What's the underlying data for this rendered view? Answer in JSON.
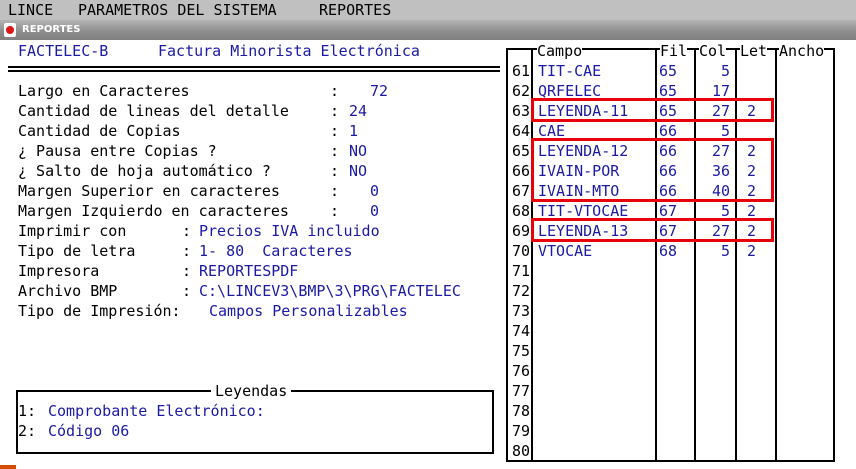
{
  "menu": [
    "LINCE",
    "PARAMETROS DEL SISTEMA",
    "REPORTES"
  ],
  "window": {
    "title": "REPORTES"
  },
  "report": {
    "code": "FACTELEC-B",
    "name": "Factura Minorista Electrónica"
  },
  "settings": [
    {
      "label": "Largo en Caracteres",
      "sep": ":",
      "value": "72"
    },
    {
      "label": "Cantidad de lineas del detalle",
      "sep": ":",
      "value": "24"
    },
    {
      "label": "Cantidad de Copias",
      "sep": ":",
      "value": "1"
    },
    {
      "label": "¿ Pausa entre Copias ?",
      "sep": ":",
      "value": "NO"
    },
    {
      "label": "¿ Salto de hoja automático ?",
      "sep": ":",
      "value": "NO"
    },
    {
      "label": "Margen Superior en caracteres",
      "sep": ":",
      "value": "0"
    },
    {
      "label": "Margen Izquierdo en caracteres",
      "sep": ":",
      "value": "0"
    },
    {
      "label": "Imprimir con",
      "sep": ":",
      "value": "Precios IVA incluido"
    },
    {
      "label": "Tipo de letra",
      "sep": ":",
      "value": "1- 80  Caracteres"
    },
    {
      "label": "Impresora",
      "sep": ":",
      "value": "REPORTESPDF"
    },
    {
      "label": "Archivo BMP",
      "sep": ":",
      "value": "C:\\LINCEV3\\BMP\\3\\PRG\\FACTELEC"
    },
    {
      "label": "Tipo de Impresión:",
      "sep": "",
      "value": "Campos Personalizables"
    }
  ],
  "leyendas": {
    "title": "Leyendas",
    "items": [
      {
        "index": "1:",
        "text": "Comprobante Electrónico:"
      },
      {
        "index": "2:",
        "text": "Código 06"
      }
    ]
  },
  "table": {
    "headers": {
      "campo": "Campo",
      "fil": "Fil",
      "col": "Col",
      "let": "Let",
      "ancho": "Ancho"
    },
    "rows": [
      {
        "n": "61",
        "campo": "TIT-CAE",
        "fil": "65",
        "col": "5",
        "let": ""
      },
      {
        "n": "62",
        "campo": "QRFELEC",
        "fil": "65",
        "col": "17",
        "let": ""
      },
      {
        "n": "63",
        "campo": "LEYENDA-11",
        "fil": "65",
        "col": "27",
        "let": "2"
      },
      {
        "n": "64",
        "campo": "CAE",
        "fil": "66",
        "col": "5",
        "let": ""
      },
      {
        "n": "65",
        "campo": "LEYENDA-12",
        "fil": "66",
        "col": "27",
        "let": "2"
      },
      {
        "n": "66",
        "campo": "IVAIN-POR",
        "fil": "66",
        "col": "36",
        "let": "2"
      },
      {
        "n": "67",
        "campo": "IVAIN-MTO",
        "fil": "66",
        "col": "40",
        "let": "2"
      },
      {
        "n": "68",
        "campo": "TIT-VTOCAE",
        "fil": "67",
        "col": "5",
        "let": "2"
      },
      {
        "n": "69",
        "campo": "LEYENDA-13",
        "fil": "67",
        "col": "27",
        "let": "2"
      },
      {
        "n": "70",
        "campo": "VTOCAE",
        "fil": "68",
        "col": "5",
        "let": "2"
      },
      {
        "n": "71",
        "campo": "",
        "fil": "",
        "col": "",
        "let": ""
      },
      {
        "n": "72",
        "campo": "",
        "fil": "",
        "col": "",
        "let": ""
      },
      {
        "n": "73",
        "campo": "",
        "fil": "",
        "col": "",
        "let": ""
      },
      {
        "n": "74",
        "campo": "",
        "fil": "",
        "col": "",
        "let": ""
      },
      {
        "n": "75",
        "campo": "",
        "fil": "",
        "col": "",
        "let": ""
      },
      {
        "n": "76",
        "campo": "",
        "fil": "",
        "col": "",
        "let": ""
      },
      {
        "n": "77",
        "campo": "",
        "fil": "",
        "col": "",
        "let": ""
      },
      {
        "n": "78",
        "campo": "",
        "fil": "",
        "col": "",
        "let": ""
      },
      {
        "n": "79",
        "campo": "",
        "fil": "",
        "col": "",
        "let": ""
      },
      {
        "n": "80",
        "campo": "",
        "fil": "",
        "col": "",
        "let": ""
      }
    ]
  },
  "highlighted_groups": [
    {
      "from": "63",
      "to": "63"
    },
    {
      "from": "65",
      "to": "67"
    },
    {
      "from": "69",
      "to": "69"
    }
  ],
  "colors": {
    "text_fields": "#1a1aa6",
    "highlight": "#e8000b",
    "titlebar": "#8e8e8e",
    "menubar": "#c0c0c0"
  }
}
